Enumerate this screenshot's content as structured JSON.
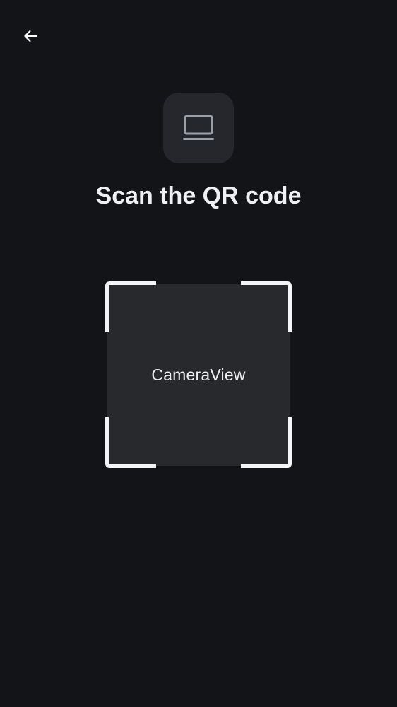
{
  "header": {
    "back_icon": "arrow-left-icon"
  },
  "device": {
    "icon": "laptop-icon"
  },
  "title": "Scan the QR code",
  "scanner": {
    "camera_label": "CameraView"
  },
  "colors": {
    "background": "#121418",
    "tile": "#25272c",
    "camera": "#28292d",
    "text": "#eef0f3",
    "icon": "#9aa0a8"
  }
}
